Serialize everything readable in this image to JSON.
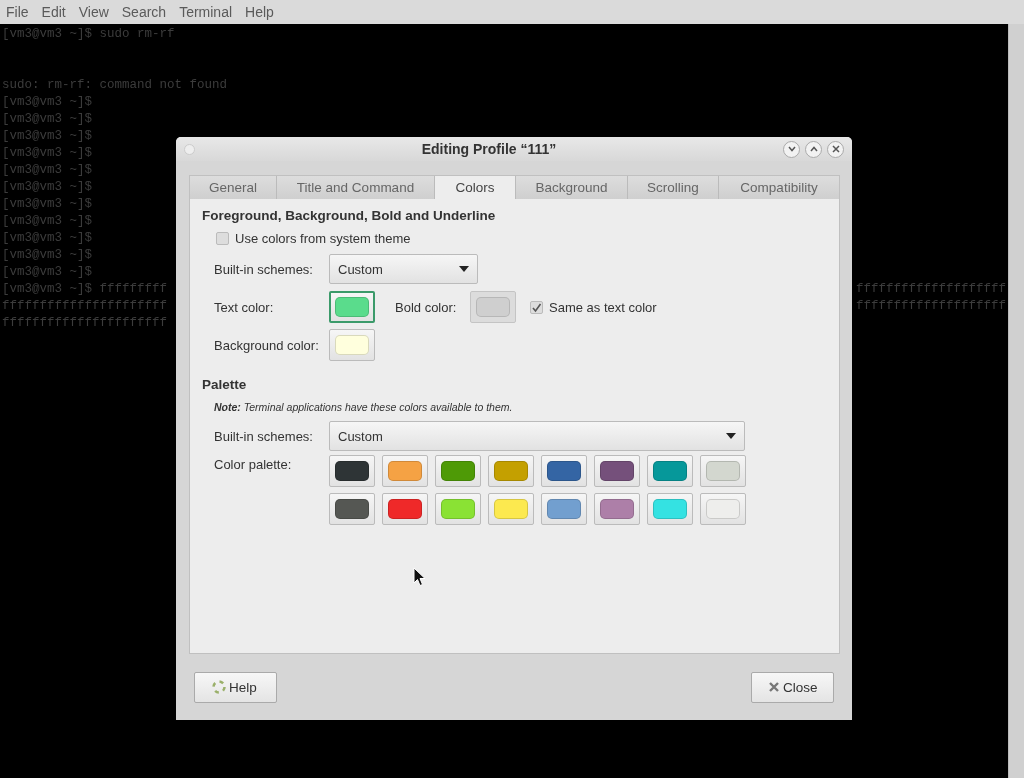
{
  "menubar": [
    "File",
    "Edit",
    "View",
    "Search",
    "Terminal",
    "Help"
  ],
  "terminal": {
    "lines": [
      {
        "kind": "text",
        "left": "[vm3@vm3 ~]$ sudo rm-rf"
      },
      {
        "kind": "blank"
      },
      {
        "kind": "blank"
      },
      {
        "kind": "text",
        "left": "sudo: rm-rf: command not found"
      },
      {
        "kind": "text",
        "left": "[vm3@vm3 ~]$"
      },
      {
        "kind": "text",
        "left": "[vm3@vm3 ~]$"
      },
      {
        "kind": "text",
        "left": "[vm3@vm3 ~]$"
      },
      {
        "kind": "text",
        "left": "[vm3@vm3 ~]$"
      },
      {
        "kind": "text",
        "left": "[vm3@vm3 ~]$"
      },
      {
        "kind": "text",
        "left": "[vm3@vm3 ~]$"
      },
      {
        "kind": "text",
        "left": "[vm3@vm3 ~]$"
      },
      {
        "kind": "text",
        "left": "[vm3@vm3 ~]$"
      },
      {
        "kind": "text",
        "left": "[vm3@vm3 ~]$"
      },
      {
        "kind": "text",
        "left": "[vm3@vm3 ~]$"
      },
      {
        "kind": "text",
        "left": "[vm3@vm3 ~]$"
      },
      {
        "kind": "text",
        "left": "[vm3@vm3 ~]$ fffffffff",
        "right": "ffffffffffffffffffff"
      },
      {
        "kind": "text",
        "left": "ffffffffffffffffffffff",
        "right": "ffffffffffffffffffff"
      },
      {
        "kind": "text",
        "left": "ffffffffffffffffffffff"
      }
    ]
  },
  "dialog": {
    "title": "Editing Profile “111”",
    "tabs": [
      {
        "label": "General",
        "selected": false
      },
      {
        "label": "Title and Command",
        "selected": false
      },
      {
        "label": "Colors",
        "selected": true
      },
      {
        "label": "Background",
        "selected": false
      },
      {
        "label": "Scrolling",
        "selected": false
      },
      {
        "label": "Compatibility",
        "selected": false
      }
    ],
    "fg_heading": "Foreground, Background, Bold and Underline",
    "use_system": {
      "label": "Use colors from system theme",
      "checked": false
    },
    "schemes": {
      "label": "Built-in schemes:",
      "value": "Custom"
    },
    "text_color": {
      "label": "Text color:",
      "color": "#5adc8c",
      "focused": true
    },
    "bold_color": {
      "label": "Bold color:",
      "color": "#c8c8c8",
      "disabled": true
    },
    "same_as_text": {
      "label": "Same as text color",
      "checked": true
    },
    "background_color": {
      "label": "Background color:",
      "color": "#ffffdd"
    },
    "palette_heading": "Palette",
    "note": "**Note:** Terminal applications have these colors available to them.",
    "palette_schemes": {
      "label": "Built-in schemes:",
      "value": "Custom"
    },
    "palette": {
      "label": "Color palette:",
      "colors": [
        {
          "color": "#2e3436"
        },
        {
          "color": "#f5a244"
        },
        {
          "color": "#4e9a06"
        },
        {
          "color": "#c4a000"
        },
        {
          "color": "#3465a4"
        },
        {
          "color": "#75507b"
        },
        {
          "color": "#06989a"
        },
        {
          "color": "#d3d7cf"
        },
        {
          "color": "#555753"
        },
        {
          "color": "#ef2929"
        },
        {
          "color": "#8ae234"
        },
        {
          "color": "#fce94f"
        },
        {
          "color": "#729fcf"
        },
        {
          "color": "#ad7fa8"
        },
        {
          "color": "#34e2e2"
        },
        {
          "color": "#eeeeec"
        }
      ]
    },
    "buttons": [
      {
        "kind": "help",
        "label": "Help"
      },
      {
        "kind": "close",
        "label": "Close"
      }
    ]
  }
}
